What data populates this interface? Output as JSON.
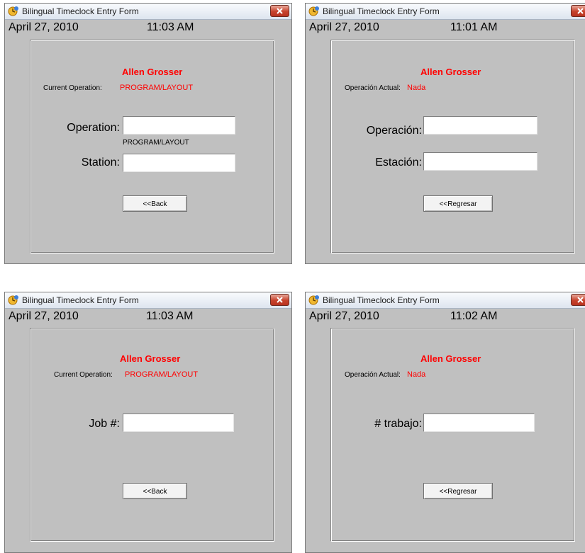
{
  "windows": [
    {
      "title": "Bilingual Timeclock Entry Form",
      "date": "April 27, 2010",
      "time": "11:03 AM",
      "user_name": "Allen Grosser",
      "operation_label": "Current Operation:",
      "operation_value": "PROGRAM/LAYOUT",
      "field1_label": "Operation:",
      "field1_hint": "PROGRAM/LAYOUT",
      "field2_label": "Station:",
      "back_label": "<<Back"
    },
    {
      "title": "Bilingual Timeclock Entry Form",
      "date": "April 27, 2010",
      "time": "11:01 AM",
      "user_name": "Allen Grosser",
      "operation_label": "Operación Actual:",
      "operation_value": "Nada",
      "field1_label": "Operación:",
      "field2_label": "Estación:",
      "back_label": "<<Regresar"
    },
    {
      "title": "Bilingual Timeclock Entry Form",
      "date": "April 27, 2010",
      "time": "11:03 AM",
      "user_name": "Allen Grosser",
      "operation_label": "Current Operation:",
      "operation_value": "PROGRAM/LAYOUT",
      "field1_label": "Job #:",
      "back_label": "<<Back"
    },
    {
      "title": "Bilingual Timeclock Entry Form",
      "date": "April 27, 2010",
      "time": "11:02 AM",
      "user_name": "Allen Grosser",
      "operation_label": "Operación Actual:",
      "operation_value": "Nada",
      "field1_label": "# trabajo:",
      "back_label": "<<Regresar"
    }
  ],
  "icons": {
    "app": "timeclock-app-icon",
    "close": "close-icon"
  },
  "colors": {
    "user_name": "#ff0000",
    "operation_value": "#ff0000",
    "window_background": "#c0c0c0",
    "close_button": "#c7422c"
  }
}
